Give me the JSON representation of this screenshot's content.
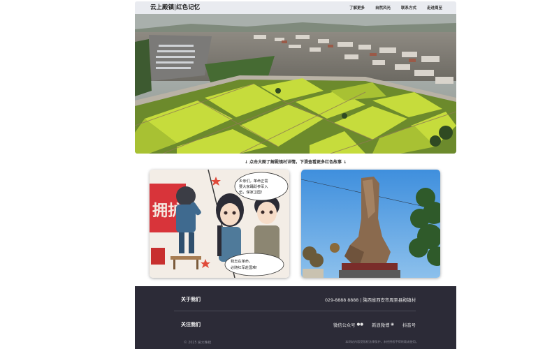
{
  "nav": {
    "brand": "云上殿镇|红色记忆",
    "links": [
      "了解更多",
      "自然风光",
      "联系方式",
      "走进周至"
    ]
  },
  "hint": "↓ 点击大图了解殿镇村详情，下滑查看更多红色故事 ↓",
  "cards": [
    {
      "speech_top": "乡亲们，革命正需要大家踊跃参军入伍，保家卫国！",
      "speech_bottom": "我志在革命，必随红军赴国难！",
      "banner": "拥护"
    }
  ],
  "footer": {
    "about_title": "关于我们",
    "contact": "029-8888 8888 | 陕西省西安市周至县殿镇村",
    "follow_title": "关注我们",
    "social": [
      {
        "label": "微信公众号",
        "icon": "wechat-icon"
      },
      {
        "label": "新浪微博",
        "icon": "weibo-icon"
      },
      {
        "label": "抖音号",
        "icon": ""
      }
    ],
    "copyright": "© 2025 爱大殊程",
    "disclaimer": "本网站内容受版权法律保护，未经授权不得转载或使用。"
  },
  "colors": {
    "footer_bg": "#2c2b37",
    "nav_bg": "#e9ebf0",
    "field_green": "#c6dc3c"
  }
}
